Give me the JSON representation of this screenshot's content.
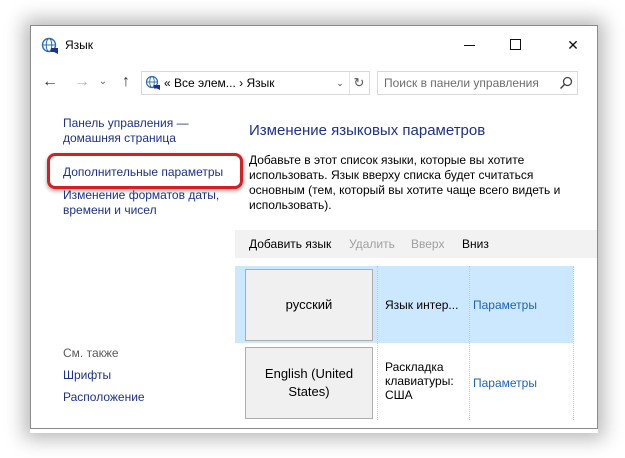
{
  "window": {
    "title": "Язык",
    "icon": "globe-language-icon"
  },
  "titlebar": {
    "close_glyph": "✕"
  },
  "address_bar": {
    "path_text": "«  Все элем...  ›  Язык",
    "refresh_glyph": "↻"
  },
  "search": {
    "placeholder": "Поиск в панели управления"
  },
  "sidebar": {
    "home_link": "Панель управления — домашняя страница",
    "advanced_settings": "Дополнительные параметры",
    "date_time_formats": "Изменение форматов даты, времени и чисел",
    "see_also": "См. также",
    "fonts": "Шрифты",
    "location": "Расположение"
  },
  "main": {
    "heading": "Изменение языковых параметров",
    "description": "Добавьте в этот список языки, которые вы хотите использовать. Язык вверху списка будет считаться основным (тем, который вы хотите чаще всего видеть и использовать)."
  },
  "toolbar": {
    "add_language": "Добавить язык",
    "remove": "Удалить",
    "up": "Вверх",
    "down": "Вниз"
  },
  "languages": [
    {
      "name": "русский",
      "info": "Язык интер...",
      "options": "Параметры",
      "selected": true
    },
    {
      "name": "English (United States)",
      "info": "Раскладка клавиатуры: США",
      "options": "Параметры",
      "selected": false
    }
  ],
  "colors": {
    "link": "#1e3287",
    "highlight_border": "#d42020",
    "selected_row": "#cce8ff"
  }
}
